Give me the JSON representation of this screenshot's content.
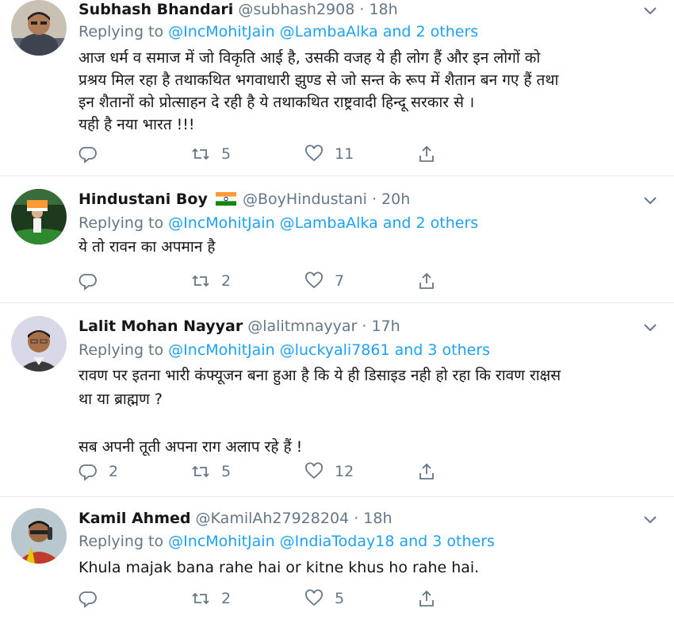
{
  "colors": {
    "accent": "#1da1f2",
    "secondary_text": "#657786",
    "primary_text": "#14171a",
    "divider": "#e6ecf0"
  },
  "tweets": [
    {
      "name": "Subhash Bhandari",
      "handle": "@subhash2908",
      "dot": "·",
      "time": "18h",
      "replying_prefix": "Replying to",
      "mention1": "@IncMohitJain",
      "mention2": "@LambaAlka",
      "others": "and 2 others",
      "text": "आज धर्म व समाज में जो विकृति आई है, उसकी वजह ये ही लोग हैं और इन लोगों को\nप्रश्रय मिल रहा है तथाकथित भगवाधारी झुण्ड से जो सन्त के रूप में शैतान बन गए हैं तथा\nइन शैतानों को प्रोत्साहन दे रही है ये तथाकथित राष्ट्रवादी हिन्दू सरकार से ।\nयही है नया भारत !!!",
      "replies": "",
      "retweets": "5",
      "likes": "11"
    },
    {
      "name": "Hindustani Boy",
      "flag_icon": "india-flag-icon",
      "handle": "@BoyHindustani",
      "dot": "·",
      "time": "20h",
      "replying_prefix": "Replying to",
      "mention1": "@IncMohitJain",
      "mention2": "@LambaAlka",
      "others": "and 2 others",
      "text": "ये तो रावन का अपमान है",
      "replies": "",
      "retweets": "2",
      "likes": "7"
    },
    {
      "name": "Lalit Mohan Nayyar",
      "handle": "@lalitmnayyar",
      "dot": "·",
      "time": "17h",
      "replying_prefix": "Replying to",
      "mention1": "@IncMohitJain",
      "mention2": "@luckyali7861",
      "others": "and 3 others",
      "text": "रावण पर इतना भारी कंफ्यूजन बना हुआ है कि ये ही डिसाइड नही हो रहा कि रावण राक्षस\nथा या ब्राह्मण ?\n\nसब अपनी तूती अपना राग अलाप रहे हैं !",
      "replies": "2",
      "retweets": "5",
      "likes": "12"
    },
    {
      "name": "Kamil Ahmed",
      "handle": "@KamilAh27928204",
      "dot": "·",
      "time": "18h",
      "replying_prefix": "Replying to",
      "mention1": "@IncMohitJain",
      "mention2": "@IndiaToday18",
      "others": "and 3 others",
      "text": "Khula majak bana rahe hai or kitne khus ho rahe hai.",
      "replies": "",
      "retweets": "2",
      "likes": "5"
    }
  ]
}
